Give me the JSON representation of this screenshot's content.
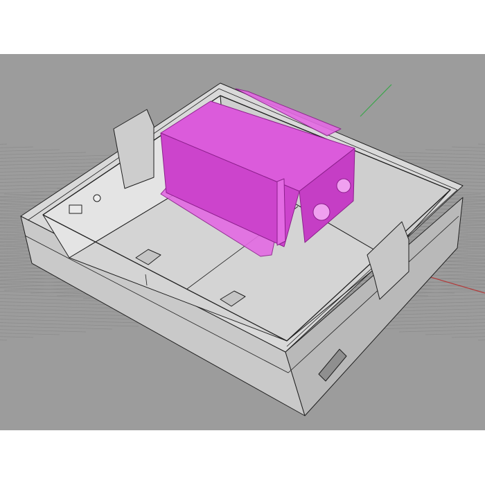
{
  "viewport": {
    "projection": "perspective",
    "display_mode": "shaded",
    "background_color": "#9c9c9c",
    "grid_color": "#8b8b8b",
    "axis_x_color": "#b23a3a",
    "axis_y_color": "#3aa64a"
  },
  "scene": {
    "objects": [
      {
        "name": "enclosure-base",
        "selected": false,
        "color": "#d2d2d2"
      },
      {
        "name": "battery-holder",
        "selected": true,
        "color": "#e36ae3"
      }
    ]
  }
}
